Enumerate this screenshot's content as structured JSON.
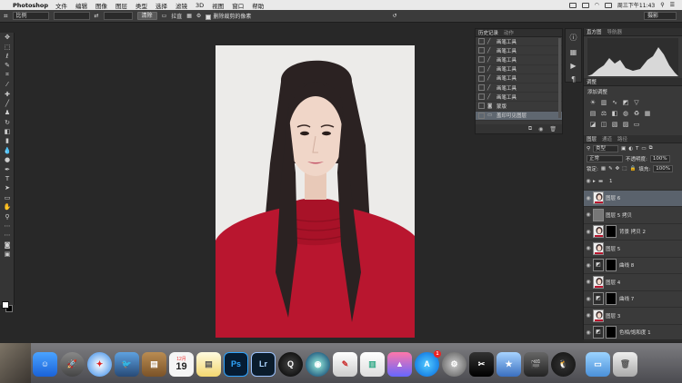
{
  "menubar": {
    "app_name": "Photoshop",
    "menus": [
      "文件",
      "编辑",
      "图像",
      "图层",
      "类型",
      "选择",
      "滤镜",
      "3D",
      "视图",
      "窗口",
      "帮助"
    ],
    "clock": "周三下午11:43"
  },
  "options_bar": {
    "ratio_label": "比例",
    "clear_button": "清除",
    "straighten_label": "拉直",
    "delete_cropped_label": "删除裁剪的像素",
    "workspace": "摄影"
  },
  "history_panel": {
    "tabs": [
      "历史记录",
      "动作"
    ],
    "items": [
      {
        "label": "画笔工具",
        "selected": false
      },
      {
        "label": "画笔工具",
        "selected": false
      },
      {
        "label": "画笔工具",
        "selected": false
      },
      {
        "label": "画笔工具",
        "selected": false
      },
      {
        "label": "画笔工具",
        "selected": false
      },
      {
        "label": "画笔工具",
        "selected": false
      },
      {
        "label": "画笔工具",
        "selected": false
      },
      {
        "label": "蒙版",
        "selected": false
      },
      {
        "label": "盖印可见图层",
        "selected": true
      }
    ]
  },
  "right_panels": {
    "histogram_tabs": [
      "直方图",
      "导航器"
    ],
    "adjust_tab": "调整",
    "adjust_title": "添加调整",
    "layers_tabs": [
      "图层",
      "通道",
      "路径"
    ],
    "kind_filter": "类型",
    "blend_mode": "正常",
    "opacity_label": "不透明度:",
    "opacity_value": "100%",
    "lock_label": "锁定:",
    "fill_label": "填充:",
    "fill_value": "100%"
  },
  "layers": [
    {
      "name": "1",
      "type": "group",
      "selected": false
    },
    {
      "name": "图层 6",
      "type": "pixel",
      "selected": true
    },
    {
      "name": "图层 5 拷贝",
      "type": "gray",
      "selected": false
    },
    {
      "name": "背景 拷贝 2",
      "type": "pixel-mask",
      "selected": false
    },
    {
      "name": "图层 5",
      "type": "pixel",
      "selected": false
    },
    {
      "name": "曲线 8",
      "type": "adjust",
      "selected": false
    },
    {
      "name": "图层 4",
      "type": "pixel",
      "selected": false
    },
    {
      "name": "曲线 7",
      "type": "adjust",
      "selected": false
    },
    {
      "name": "图层 3",
      "type": "pixel",
      "selected": false
    },
    {
      "name": "色相/饱和度 1",
      "type": "adjust",
      "selected": false
    }
  ],
  "dock": {
    "calendar_month": "12月",
    "calendar_day": "19",
    "ps_label": "Ps",
    "lr_label": "Lr",
    "appstore_badge": "1"
  }
}
